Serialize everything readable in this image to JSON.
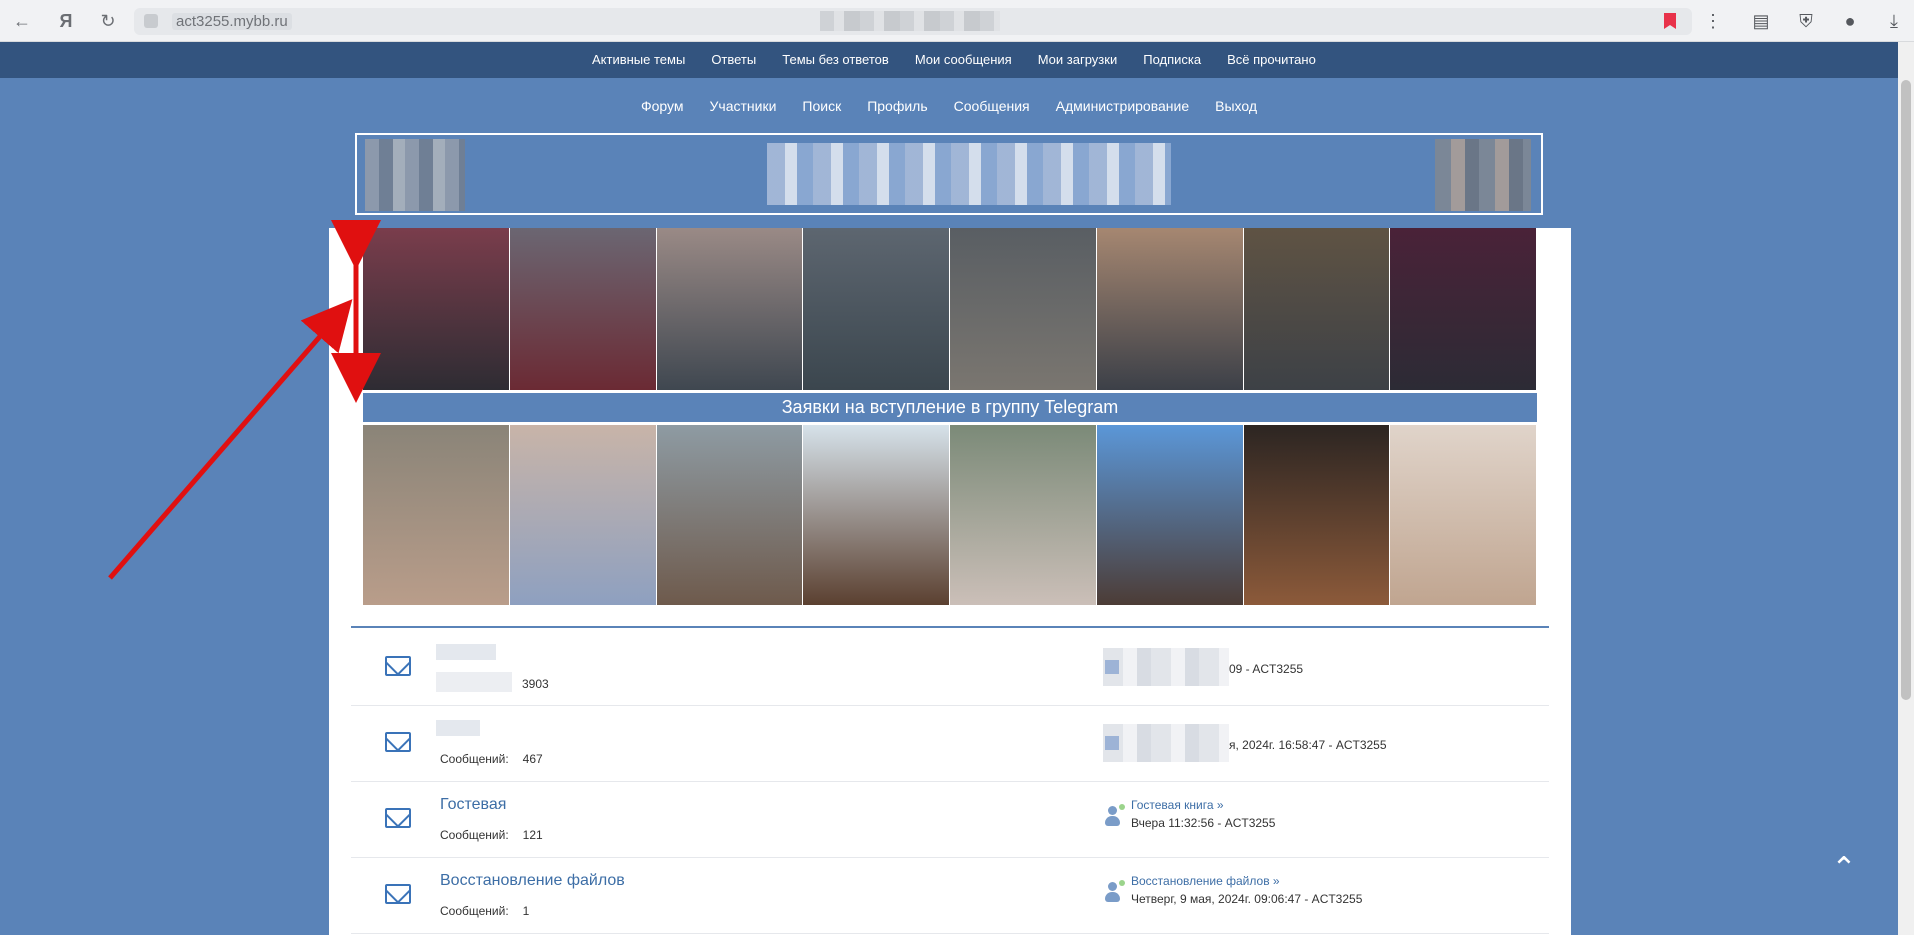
{
  "browser": {
    "url": "act3255.mybb.ru",
    "icons": [
      "back-icon",
      "yandex-icon",
      "reload-icon",
      "lock-icon",
      "bookmark-icon",
      "menu-icon",
      "reader-icon",
      "shield-icon",
      "avatar-icon",
      "download-icon"
    ]
  },
  "topbar": {
    "items": [
      "Активные темы",
      "Ответы",
      "Темы без ответов",
      "Мои сообщения",
      "Мои загрузки",
      "Подписка",
      "Всё прочитано"
    ]
  },
  "mainnav": {
    "items": [
      "Форум",
      "Участники",
      "Поиск",
      "Профиль",
      "Сообщения",
      "Администрирование",
      "Выход"
    ]
  },
  "banner": {
    "telegram_text": "Заявки на вступление в группу Telegram"
  },
  "forums": [
    {
      "name": "",
      "stats_label": "",
      "count": "3903",
      "last_post": "09 - ACT3255",
      "last_link": ""
    },
    {
      "name": "",
      "stats_label": "Сообщений:",
      "count": "467",
      "last_post": "я, 2024г. 16:58:47 - ACT3255",
      "last_link": ""
    },
    {
      "name": "Гостевая",
      "stats_label": "Сообщений:",
      "count": "121",
      "last_link": "Гостевая книга »",
      "last_post": "Вчера 11:32:56 - ACT3255"
    },
    {
      "name": "Восстановление файлов",
      "stats_label": "Сообщений:",
      "count": "1",
      "last_link": "Восстановление файлов »",
      "last_post": "Четверг, 9 мая, 2024г. 09:06:47 - ACT3255"
    }
  ],
  "colors": {
    "page_bg": "#5a83b8",
    "topbar_bg": "#33547f",
    "link": "#3d6ea6",
    "annotation": "#e01010"
  }
}
